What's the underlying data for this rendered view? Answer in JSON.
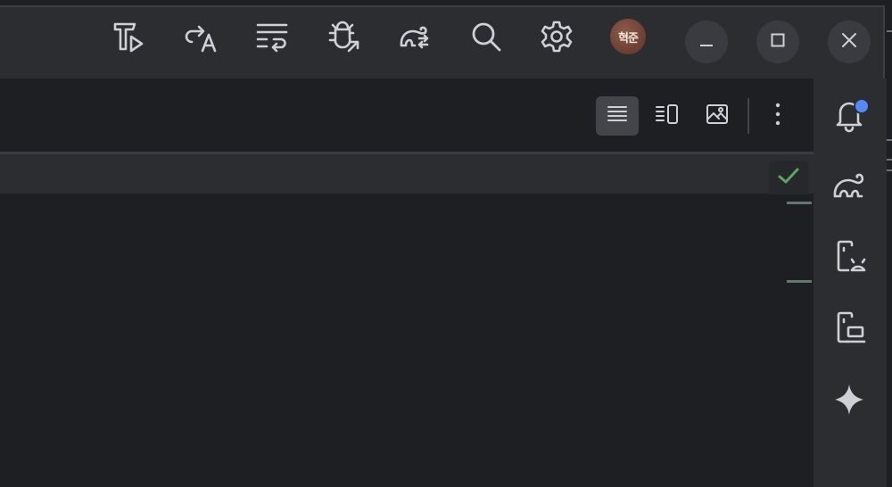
{
  "titlebar": {
    "avatar_text": "혁준",
    "icons": [
      "build-run-icon",
      "translate-icon",
      "wrap-icon",
      "debug-attach-icon",
      "gradle-sync-icon",
      "search-icon",
      "settings-icon"
    ]
  },
  "window_controls": [
    "minimize-icon",
    "maximize-icon",
    "close-icon"
  ],
  "editor_toolbar": {
    "views": [
      "code-view-icon",
      "split-view-icon",
      "design-view-icon"
    ],
    "active_view": "code-view-icon"
  },
  "right_rail": {
    "icons": [
      "notifications-icon",
      "gradle-icon",
      "device-manager-icon",
      "running-devices-icon",
      "gemini-icon"
    ],
    "notification_dot": true
  },
  "colors": {
    "background": "#1e1f22",
    "panel": "#2b2d30",
    "accent_blue": "#548af7",
    "check_green": "#5aa563",
    "icon": "#ced0d6"
  }
}
